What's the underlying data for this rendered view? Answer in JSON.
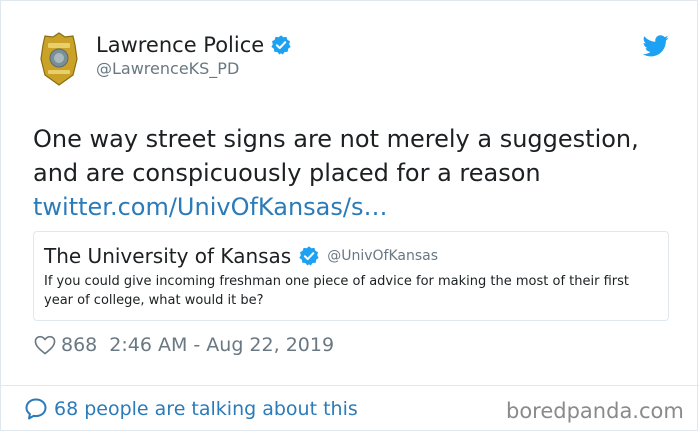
{
  "author": {
    "name": "Lawrence Police",
    "handle": "@LawrenceKS_PD",
    "avatar_icon": "police-badge-icon",
    "verified": true
  },
  "tweet": {
    "line1": "One way street signs are not merely a suggestion,",
    "line2": "and are conspicuously placed for a reason",
    "link": "twitter.com/UnivOfKansas/s…"
  },
  "quoted_tweet": {
    "name": "The University of Kansas",
    "handle": "@UnivOfKansas",
    "verified": true,
    "text": "If you could give incoming freshman one piece of advice for making the most of their first year of college, what would it be?"
  },
  "meta": {
    "likes": "868",
    "timestamp": "2:46 AM - Aug 22, 2019"
  },
  "footer": {
    "talking": "68 people are talking about this",
    "watermark": "boredpanda.com"
  },
  "colors": {
    "link": "#2b7bb9",
    "verified": "#1da1f2",
    "muted": "#697882",
    "border": "#e1e8ed"
  }
}
